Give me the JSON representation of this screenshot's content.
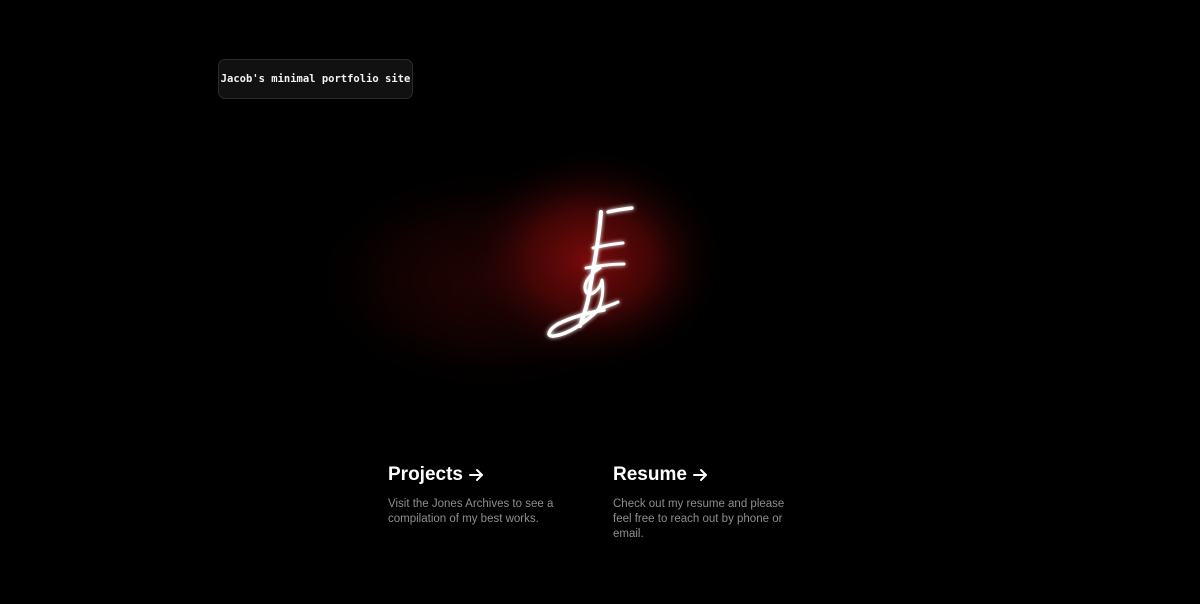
{
  "header": {
    "badge_text": "Jacob's minimal portfolio site"
  },
  "logo": {
    "icon": "signature-logo-icon",
    "glow_color": "#7a0a0a",
    "stroke_color": "#ffffff"
  },
  "links": [
    {
      "heading": "Projects",
      "arrow_icon": "arrow-right-icon",
      "description": "Visit the Jones Archives to see a compilation of my best works."
    },
    {
      "heading": "Resume",
      "arrow_icon": "arrow-right-icon",
      "description": "Check out my resume and please feel free to reach out by phone or email."
    }
  ]
}
